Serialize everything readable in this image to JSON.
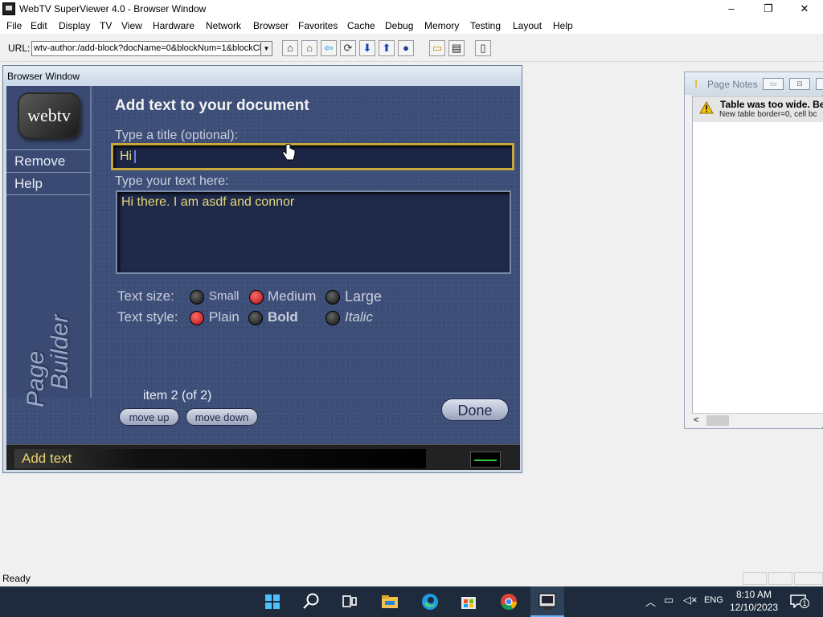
{
  "window": {
    "title": "WebTV SuperViewer 4.0 - Browser Window",
    "minimize": "–",
    "restore": "❐",
    "close": "✕"
  },
  "menu": [
    "File",
    "Edit",
    "Display",
    "TV",
    "View",
    "Hardware",
    "Network",
    "Browser",
    "Favorites",
    "Cache",
    "Debug",
    "Memory",
    "Testing",
    "Layout",
    "Help"
  ],
  "toolbar": {
    "url_label": "URL:",
    "url_value": "wtv-author:/add-block?docName=0&blockNum=1&blockCl",
    "url_dropdown": "▼",
    "buttons": [
      {
        "name": "home-tv-icon",
        "glyph": "⌂"
      },
      {
        "name": "home-icon",
        "glyph": "⌂"
      },
      {
        "name": "back-icon",
        "glyph": "⇦"
      },
      {
        "name": "reload-icon",
        "glyph": "⟳"
      },
      {
        "name": "arrow-down-icon",
        "glyph": "⬇"
      },
      {
        "name": "arrow-up-icon",
        "glyph": "⬆"
      },
      {
        "name": "stop-icon",
        "glyph": "●"
      },
      {
        "name": "open-folder-icon",
        "glyph": "▭"
      },
      {
        "name": "save-icon",
        "glyph": "▤"
      },
      {
        "name": "page-icon",
        "glyph": "▯"
      }
    ]
  },
  "browser_window": {
    "title": "Browser Window",
    "logo_text": "webtv",
    "sidebar": [
      "Remove",
      "Help"
    ],
    "brand_vertical": [
      "Page",
      "Builder"
    ],
    "heading": "Add text to your document",
    "title_label": "Type a title (optional):",
    "title_value": "Hi",
    "text_label": "Type your text here:",
    "text_value": "Hi there. I am asdf and connor",
    "text_size_label": "Text size:",
    "text_sizes": [
      "Small",
      "Medium",
      "Large"
    ],
    "text_size_selected": "Medium",
    "text_style_label": "Text style:",
    "text_styles": [
      "Plain",
      "Bold",
      "Italic"
    ],
    "text_style_selected": "Plain",
    "item_count": "item 2 (of 2)",
    "move_up": "move up",
    "move_down": "move down",
    "done": "Done",
    "status": "Add text"
  },
  "page_notes": {
    "title": "Page Notes",
    "warning_title": "Table was too wide. Be",
    "warning_detail": "New table border=0, cell bc"
  },
  "statusbar": {
    "text": "Ready"
  },
  "taskbar": {
    "time": "8:10 AM",
    "date": "12/10/2023",
    "language": "ENG",
    "notification_count": "1"
  }
}
